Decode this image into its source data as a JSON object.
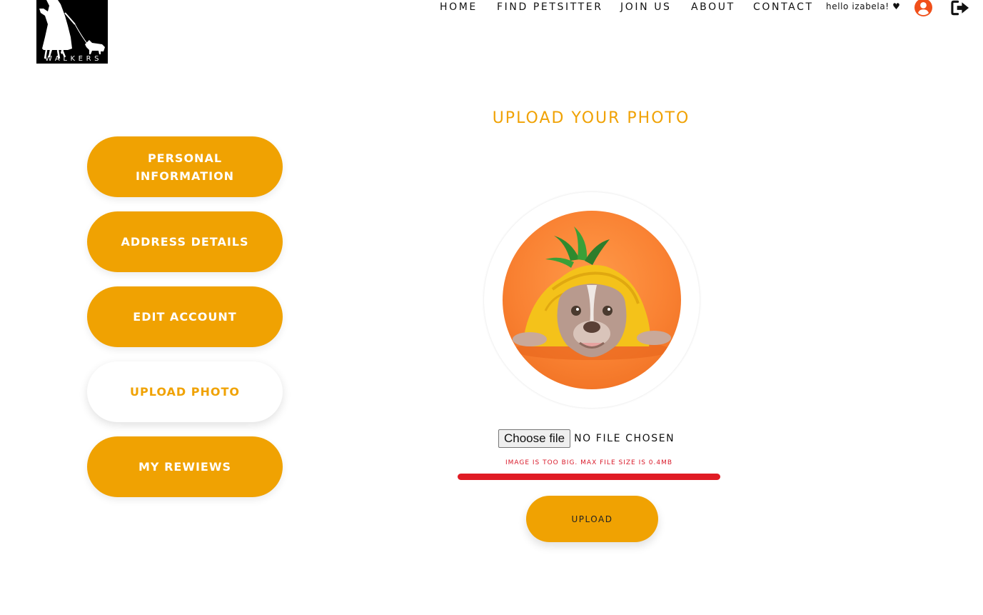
{
  "brand": {
    "logo_text": "WALKERS"
  },
  "nav": {
    "items": [
      {
        "label": "HOME"
      },
      {
        "label": "FIND PETSITTER"
      },
      {
        "label": "JOIN US"
      },
      {
        "label": "ABOUT"
      },
      {
        "label": "CONTACT"
      }
    ],
    "greeting": "hello izabela! ♥",
    "user_icon": "user-circle-icon",
    "logout_icon": "sign-out-icon",
    "icon_color": "#f04f1a"
  },
  "main": {
    "title": "UPLOAD YOUR PHOTO",
    "sidebar": [
      {
        "label": "PERSONAL INFORMATION",
        "active": false
      },
      {
        "label": "ADDRESS DETAILS",
        "active": false
      },
      {
        "label": "EDIT ACCOUNT",
        "active": false
      },
      {
        "label": "UPLOAD PHOTO",
        "active": true
      },
      {
        "label": "MY REWIEWS",
        "active": false
      }
    ],
    "file_input": {
      "button_label": "Choose file",
      "status": "NO FILE CHOSEN"
    },
    "error": "IMAGE IS TOO BIG. MAX FILE SIZE IS 0.4MB",
    "upload_label": "UPLOAD"
  },
  "colors": {
    "accent": "#f0a202",
    "error": "#e01b24"
  }
}
